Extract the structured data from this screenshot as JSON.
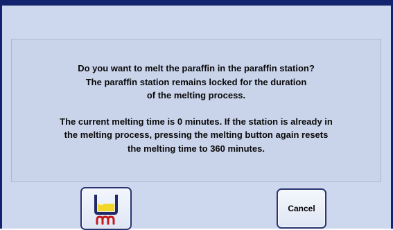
{
  "dialog": {
    "message": {
      "paragraph1": [
        "Do you want to melt the paraffin in the paraffin station?",
        "The paraffin station remains locked for the duration",
        "of the melting process."
      ],
      "paragraph2": [
        "The current melting time is 0 minutes. If the station is already in",
        "the melting process, pressing the melting button again resets",
        "the melting time to 360 minutes."
      ]
    },
    "buttons": {
      "melt_icon": "paraffin-melt-icon",
      "cancel_label": "Cancel"
    }
  }
}
